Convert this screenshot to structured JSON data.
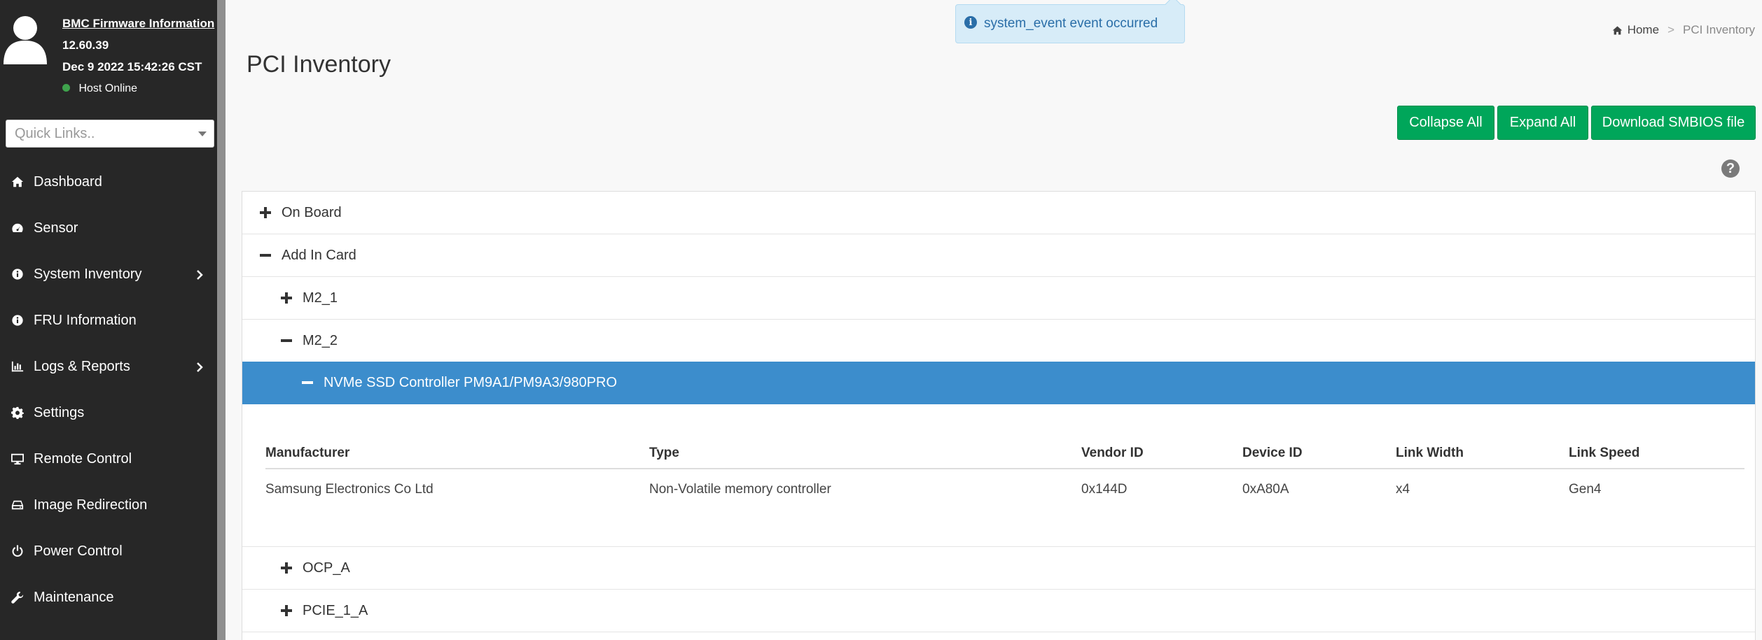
{
  "user": {
    "firmware_label": "BMC Firmware Information",
    "firmware_version": "12.60.39",
    "datetime": "Dec 9 2022 15:42:26 CST",
    "host_status": "Host Online"
  },
  "quick_links": {
    "placeholder": "Quick Links.."
  },
  "nav": [
    {
      "label": "Dashboard",
      "icon": "home-icon",
      "expandable": false
    },
    {
      "label": "Sensor",
      "icon": "dashboard-gauge-icon",
      "expandable": false
    },
    {
      "label": "System Inventory",
      "icon": "info-circle-icon",
      "expandable": true
    },
    {
      "label": "FRU Information",
      "icon": "info-circle-icon",
      "expandable": false
    },
    {
      "label": "Logs & Reports",
      "icon": "bar-chart-icon",
      "expandable": true
    },
    {
      "label": "Settings",
      "icon": "gear-icon",
      "expandable": false
    },
    {
      "label": "Remote Control",
      "icon": "desktop-icon",
      "expandable": false
    },
    {
      "label": "Image Redirection",
      "icon": "hdd-icon",
      "expandable": false
    },
    {
      "label": "Power Control",
      "icon": "power-icon",
      "expandable": false
    },
    {
      "label": "Maintenance",
      "icon": "wrench-icon",
      "expandable": false
    }
  ],
  "page": {
    "title": "PCI Inventory"
  },
  "breadcrumb": {
    "home": "Home",
    "separator": ">",
    "current": "PCI Inventory"
  },
  "toast": {
    "message": "system_event event occurred"
  },
  "buttons": {
    "collapse_all": "Collapse All",
    "expand_all": "Expand All",
    "download": "Download SMBIOS file"
  },
  "help": {
    "symbol": "?"
  },
  "tree": {
    "on_board": "On Board",
    "add_in_card": "Add In Card",
    "m2_1": "M2_1",
    "m2_2": "M2_2",
    "nvme": "NVMe SSD Controller PM9A1/PM9A3/980PRO",
    "ocp_a": "OCP_A",
    "pcie_1_a": "PCIE_1_A"
  },
  "details": {
    "headers": [
      "Manufacturer",
      "Type",
      "Vendor ID",
      "Device ID",
      "Link Width",
      "Link Speed"
    ],
    "row": [
      "Samsung Electronics Co Ltd",
      "Non-Volatile memory controller",
      "0x144D",
      "0xA80A",
      "x4",
      "Gen4"
    ]
  },
  "colors": {
    "sidebar_bg": "#272727",
    "accent_green": "#00a65a",
    "selected_row": "#3c8dcc",
    "toast_bg": "#d7ecf8",
    "status_online": "#3fa34d"
  }
}
